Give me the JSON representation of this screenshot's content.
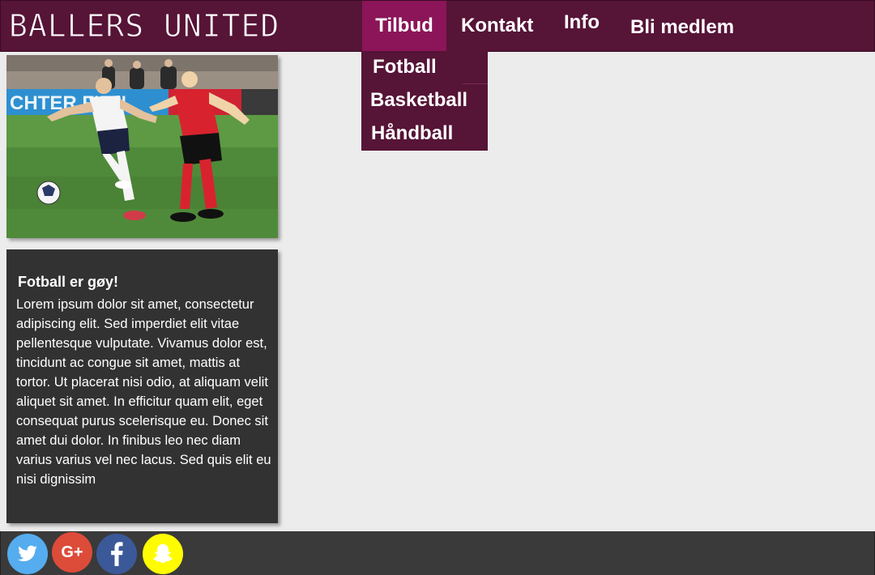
{
  "header": {
    "logo": "BALLERS UNITED",
    "nav": [
      {
        "label": "Tilbud"
      },
      {
        "label": "Kontakt"
      },
      {
        "label": "Info"
      },
      {
        "label": "Bli medlem"
      }
    ]
  },
  "dropdown": {
    "items": [
      {
        "label": "Fotball"
      },
      {
        "label": "Basketball"
      },
      {
        "label": "Håndball"
      }
    ]
  },
  "card": {
    "title": "Fotball er gøy!",
    "body": "Lorem ipsum dolor sit amet, consectetur adipiscing elit. Sed imperdiet elit vitae pellentesque vulputate. Vivamus dolor est, tincidunt ac congue sit amet, mattis at tortor. Ut placerat nisi odio, at aliquam velit aliquet sit amet. In efficitur quam elit, eget consequat purus scelerisque eu. Donec sit amet dui dolor. In finibus leo nec diam varius varius vel nec lacus. Sed quis elit eu nisi dignissim"
  },
  "footer": {
    "social": [
      {
        "icon": "twitter-icon",
        "color": "#55acee"
      },
      {
        "icon": "google-plus-icon",
        "color": "#dd4b39",
        "glyph": "G+"
      },
      {
        "icon": "facebook-icon",
        "color": "#3b5998"
      },
      {
        "icon": "snapchat-icon",
        "color": "#fffc00"
      }
    ]
  },
  "colors": {
    "header_bg": "#561437",
    "active_nav": "#8b1558",
    "card_bg": "#323232",
    "footer_bg": "#3a3a3a",
    "page_bg": "#ececec"
  }
}
